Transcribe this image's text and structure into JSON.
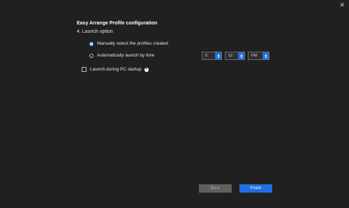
{
  "window": {
    "close_glyph": "✕"
  },
  "header": {
    "title": "Easy Arrange Profile configuration",
    "step": "4. Launch option"
  },
  "options": {
    "manual_label": "Manually select the profiles created",
    "manual_selected": true,
    "auto_label": "Automatically launch by time",
    "auto_selected": false
  },
  "time": {
    "hour": "5",
    "minute": "12",
    "period": "PM"
  },
  "startup": {
    "label": "Launch during PC startup",
    "checked": false,
    "info_glyph": "i"
  },
  "footer": {
    "back_label": "Back",
    "finish_label": "Finish"
  },
  "colors": {
    "accent": "#1f6fe0",
    "background": "#202020",
    "disabled_button": "#5f5f5f"
  }
}
